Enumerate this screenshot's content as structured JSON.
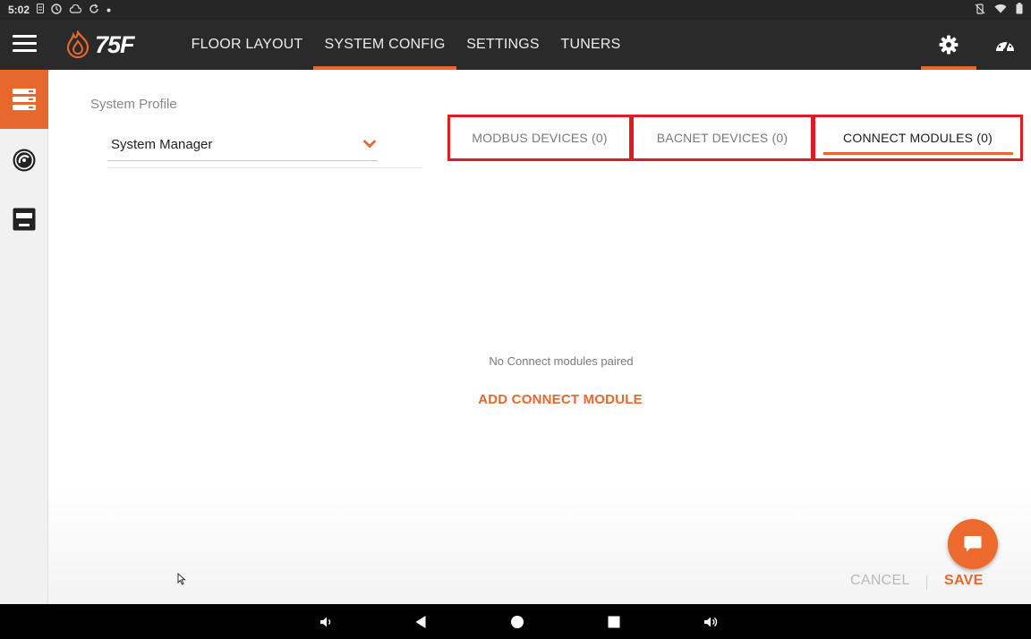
{
  "status_bar": {
    "time": "5:02"
  },
  "app_bar": {
    "brand": "75F",
    "nav_tabs": [
      {
        "label": "FLOOR LAYOUT",
        "active": false
      },
      {
        "label": "SYSTEM CONFIG",
        "active": true
      },
      {
        "label": "SETTINGS",
        "active": false
      },
      {
        "label": "TUNERS",
        "active": false
      }
    ],
    "icons": [
      "settings-gear-icon",
      "dashboard-gauge-icon"
    ]
  },
  "sidebar": {
    "items": [
      {
        "icon": "system-stack-icon",
        "active": true
      },
      {
        "icon": "dial-gauge-icon",
        "active": false
      },
      {
        "icon": "rtu-unit-icon",
        "active": false
      }
    ]
  },
  "system_profile": {
    "label": "System Profile",
    "selected": "System Manager"
  },
  "device_tabs": [
    {
      "label": "MODBUS DEVICES (0)",
      "active": false
    },
    {
      "label": "BACNET DEVICES (0)",
      "active": false
    },
    {
      "label": "CONNECT MODULES (0)",
      "active": true
    }
  ],
  "content": {
    "empty_message": "No Connect modules paired",
    "add_action": "ADD CONNECT MODULE"
  },
  "footer": {
    "cancel_label": "CANCEL",
    "save_label": "SAVE"
  },
  "colors": {
    "accent": "#e8672c",
    "app_bar": "#2a2a2a",
    "highlight_box": "#e11b22"
  }
}
